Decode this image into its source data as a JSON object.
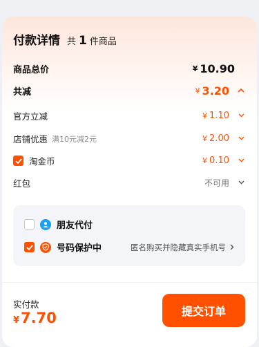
{
  "header": {
    "title": "付款详情",
    "prefix": "共",
    "count": "1",
    "unit": "件商品"
  },
  "summary": {
    "total_label": "商品总价",
    "total_currency": "¥",
    "total_amount": "10.90",
    "discount_label": "共减",
    "discount_currency": "¥",
    "discount_amount": "3.20"
  },
  "discounts": [
    {
      "label": "官方立减",
      "sub": "",
      "currency": "¥",
      "amount": "1.10"
    },
    {
      "label": "店铺优惠",
      "sub": "满10元减2元",
      "currency": "¥",
      "amount": "2.00"
    },
    {
      "label": "淘金币",
      "sub": "",
      "currency": "¥",
      "amount": "0.10",
      "checked": true
    },
    {
      "label": "红包",
      "sub": "",
      "status": "不可用"
    }
  ],
  "options": {
    "friend_pay_label": "朋友代付",
    "friend_pay_checked": false,
    "privacy_label": "号码保护中",
    "privacy_checked": true,
    "privacy_desc": "匿名购买并隐藏真实手机号"
  },
  "footer": {
    "paid_label": "实付款",
    "currency": "¥",
    "amount": "7.70",
    "submit_label": "提交订单"
  },
  "colors": {
    "accent": "#ff5000",
    "panel_bg": "#f3f5f8",
    "friend_icon": "#1aa0f5",
    "privacy_icon": "#ff5000"
  }
}
